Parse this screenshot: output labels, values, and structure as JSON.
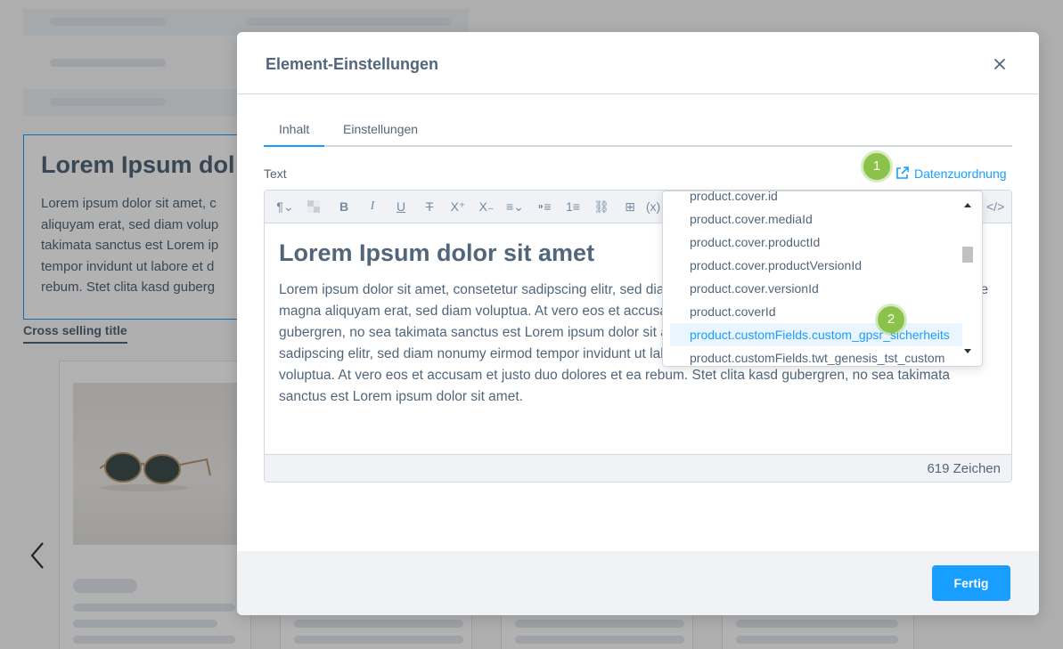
{
  "background": {
    "text_block_title": "Lorem Ipsum dol",
    "text_block_lines": [
      "Lorem ipsum dolor sit amet, c",
      "aliquyam erat, sed diam volup",
      "takimata sanctus est Lorem ip",
      "tempor invidunt ut labore et d",
      "rebum. Stet clita kasd guberg"
    ],
    "cross_selling_title": "Cross selling title"
  },
  "modal": {
    "title": "Element-Einstellungen",
    "close_icon": "close-icon",
    "tabs": [
      {
        "label": "Inhalt",
        "active": true
      },
      {
        "label": "Einstellungen",
        "active": false
      }
    ],
    "text_label": "Text",
    "data_mapping_label": "Datenzuordnung",
    "badges": [
      "1",
      "2"
    ],
    "editor": {
      "heading": "Lorem Ipsum dolor sit amet",
      "paragraph": "Lorem ipsum dolor sit amet, consetetur sadipscing elitr, sed diam nonumy eirmod tempor invidunt ut labore et dolore magna aliquyam erat, sed diam voluptua. At vero eos et accusam et justo duo dolores et ea rebum. Stet clita kasd gubergren, no sea takimata sanctus est Lorem ipsum dolor sit amet. Lorem ipsum dolor sit amet, consetetur sadipscing elitr, sed diam nonumy eirmod tempor invidunt ut labore et dolore magna aliquyam erat, sed diam voluptua. At vero eos et accusam et justo duo dolores et ea rebum. Stet clita kasd gubergren, no sea takimata sanctus est Lorem ipsum dolor sit amet.",
      "char_count": "619 Zeichen"
    },
    "done_button": "Fertig"
  },
  "dropdown": {
    "items": [
      "product.cover.id",
      "product.cover.mediaId",
      "product.cover.productId",
      "product.cover.productVersionId",
      "product.cover.versionId",
      "product.coverId",
      "product.customFields.custom_gpsr_sicherheits",
      "product.customFields.twt_genesis_tst_custom"
    ],
    "highlighted_index": 6
  },
  "colors": {
    "accent": "#189eff",
    "text": "#52667a",
    "badge": "#8bc34a"
  }
}
